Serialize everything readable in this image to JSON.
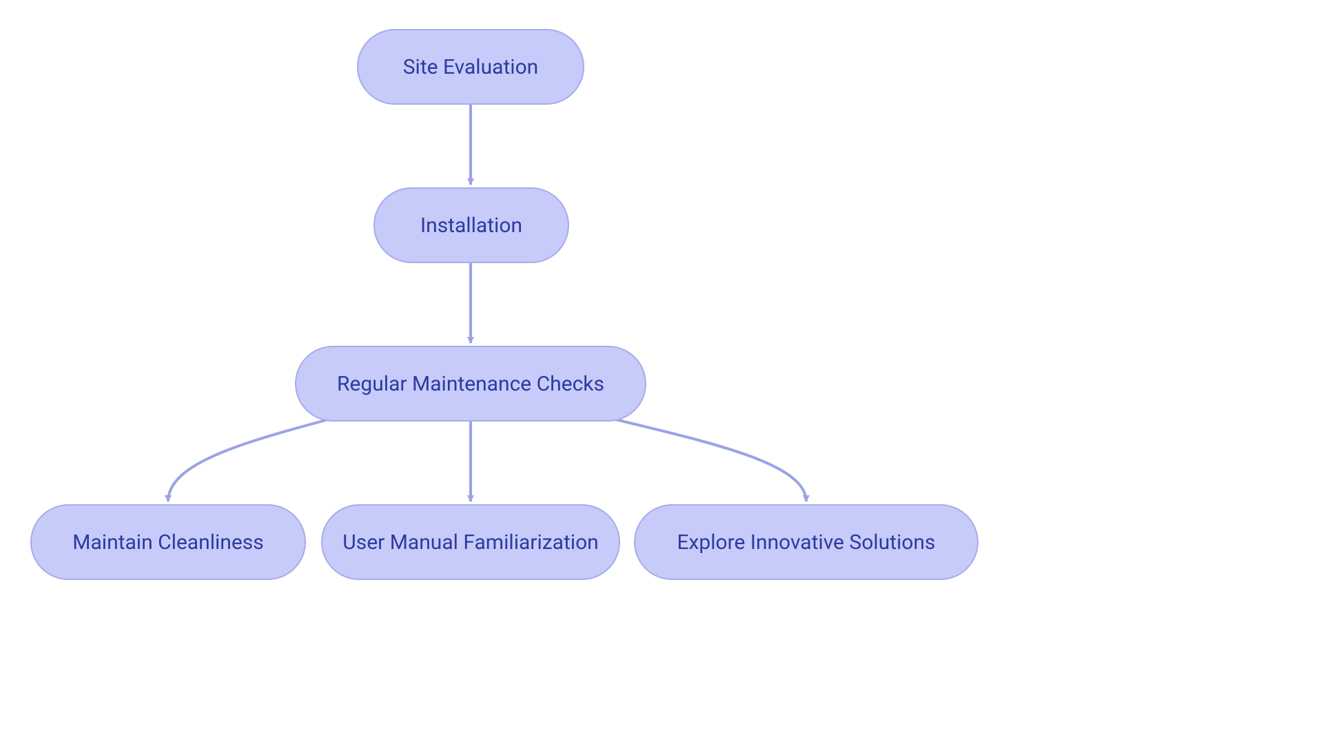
{
  "nodes": {
    "site_evaluation": "Site Evaluation",
    "installation": "Installation",
    "maintenance": "Regular Maintenance Checks",
    "cleanliness": "Maintain Cleanliness",
    "user_manual": "User Manual Familiarization",
    "innovative": "Explore Innovative Solutions"
  },
  "edges": [
    {
      "from": "site_evaluation",
      "to": "installation"
    },
    {
      "from": "installation",
      "to": "maintenance"
    },
    {
      "from": "maintenance",
      "to": "cleanliness"
    },
    {
      "from": "maintenance",
      "to": "user_manual"
    },
    {
      "from": "maintenance",
      "to": "innovative"
    }
  ],
  "style": {
    "node_fill": "#c6cbf9",
    "node_stroke": "#a6ace8",
    "edge_color": "#9ba2e6",
    "text_color": "#2d3a9e"
  }
}
